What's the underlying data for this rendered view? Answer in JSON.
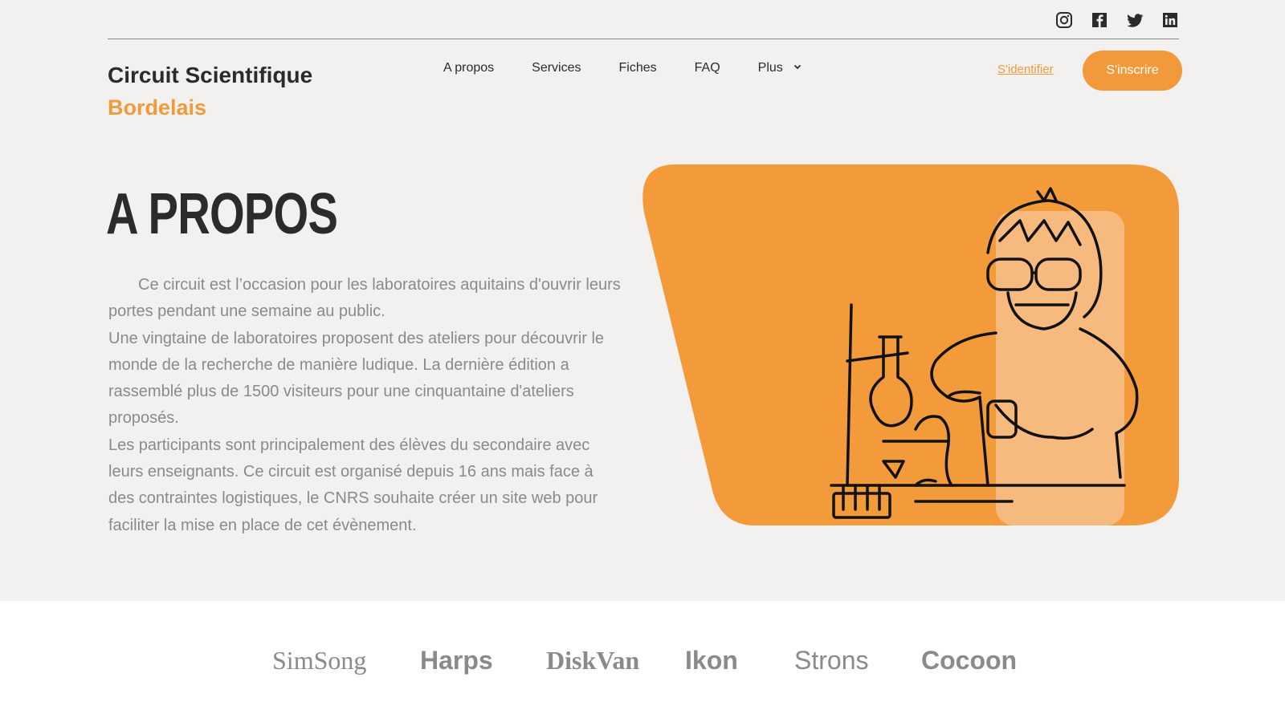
{
  "social": {
    "icons": [
      "instagram-icon",
      "facebook-icon",
      "twitter-icon",
      "linkedin-icon"
    ]
  },
  "brand": {
    "line1": "Circuit Scientifique",
    "line2": "Bordelais",
    "accent_color": "#f29a3b"
  },
  "nav": {
    "items": [
      "A propos",
      "Services",
      "Fiches",
      "FAQ"
    ],
    "more_label": "Plus"
  },
  "auth": {
    "signin_label": "S'identifier",
    "signup_label": "S'inscrire"
  },
  "about": {
    "title": "A PROPOS",
    "paragraphs": [
      "Ce circuit est l’occasion pour les laboratoires aquitains d'ouvrir leurs portes pendant une semaine au public.",
      "Une vingtaine de laboratoires proposent des ateliers pour découvrir le monde de la recherche de manière ludique. La dernière édition a rassemblé plus de 1500 visiteurs pour une cinquantaine d'ateliers proposés.",
      "Les participants sont principalement des élèves du secondaire avec leurs enseignants. Ce circuit est organisé depuis 16 ans mais face à des contraintes logistiques, le CNRS souhaite créer un site web pour faciliter la mise en place de cet évènement."
    ]
  },
  "partners": {
    "logos": [
      "SimSong",
      "Harps",
      "DiskVan",
      "Ikon",
      "Strons",
      "Cocoon"
    ]
  }
}
